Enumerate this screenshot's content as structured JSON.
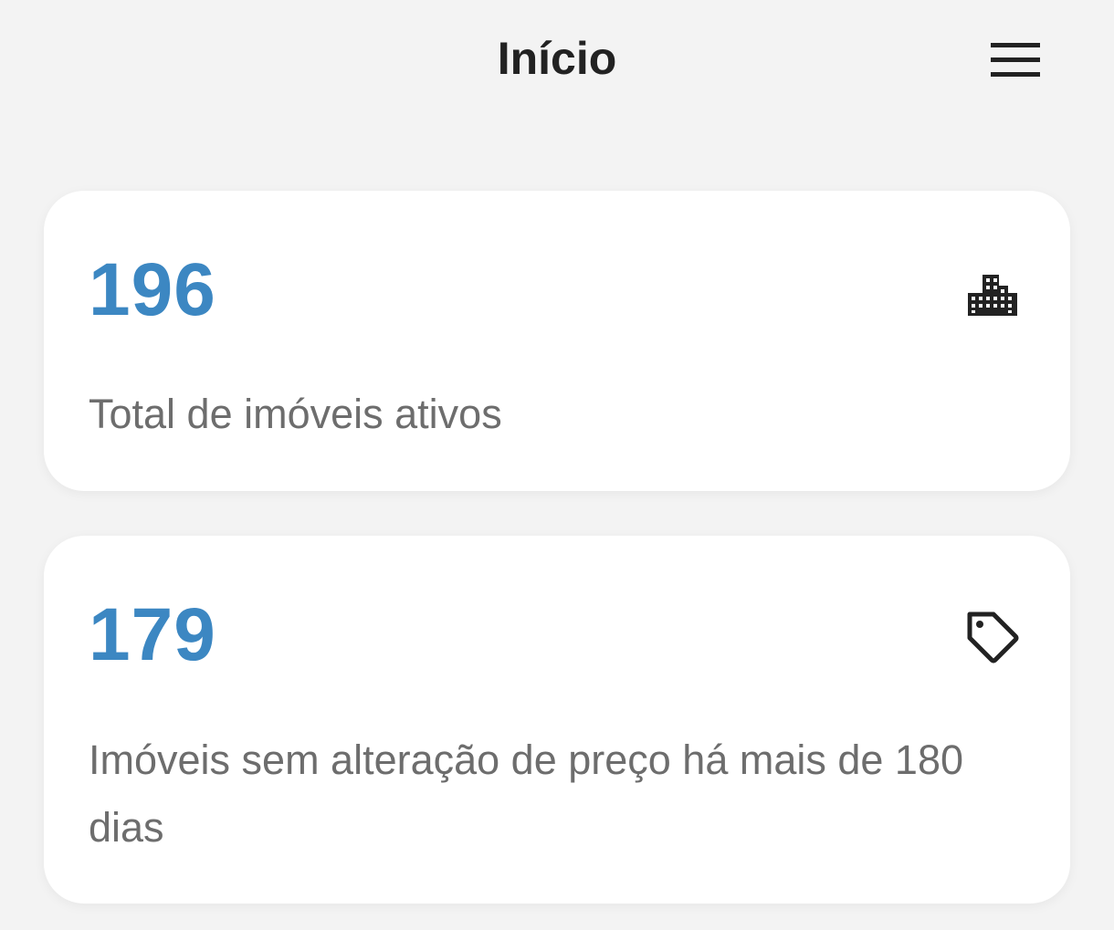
{
  "header": {
    "title": "Início",
    "menu_icon": "hamburger-menu-icon"
  },
  "cards": [
    {
      "value": "196",
      "label": "Total de imóveis ativos",
      "icon": "building-icon"
    },
    {
      "value": "179",
      "label": "Imóveis sem alteração de preço há mais de 180 dias",
      "icon": "price-tag-icon"
    }
  ],
  "colors": {
    "background": "#f3f3f3",
    "card": "#ffffff",
    "accent": "#3c87c2",
    "title": "#222222",
    "label": "#6d6d6d"
  }
}
